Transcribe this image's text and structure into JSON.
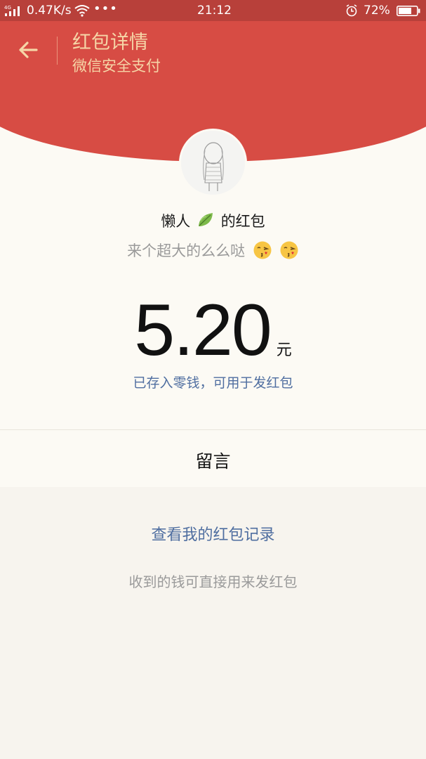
{
  "status_bar": {
    "network_type": "4G",
    "net_speed": "0.47K/s",
    "more": "•••",
    "time": "21:12",
    "battery_percent": "72%",
    "battery_level": 0.72,
    "icons": [
      "signal-icon",
      "wifi-icon",
      "alarm-icon",
      "battery-icon"
    ]
  },
  "header": {
    "title": "红包详情",
    "subtitle": "微信安全支付",
    "back_icon": "arrow-left-icon",
    "accent_color": "#d74c44",
    "title_color": "#f6d6a7"
  },
  "packet": {
    "sender_name": "懒人",
    "sender_suffix": "的红包",
    "sender_emoji": "leaf-icon",
    "wish_text": "来个超大的么么哒",
    "wish_emojis": [
      "kiss-face-icon",
      "kiss-face-icon"
    ],
    "amount": "5.20",
    "unit": "元",
    "saved_text": "已存入零钱，可用于发红包",
    "link_color": "#4f6ea0"
  },
  "leave_message_label": "留言",
  "records_link": "查看我的红包记录",
  "note": "收到的钱可直接用来发红包"
}
